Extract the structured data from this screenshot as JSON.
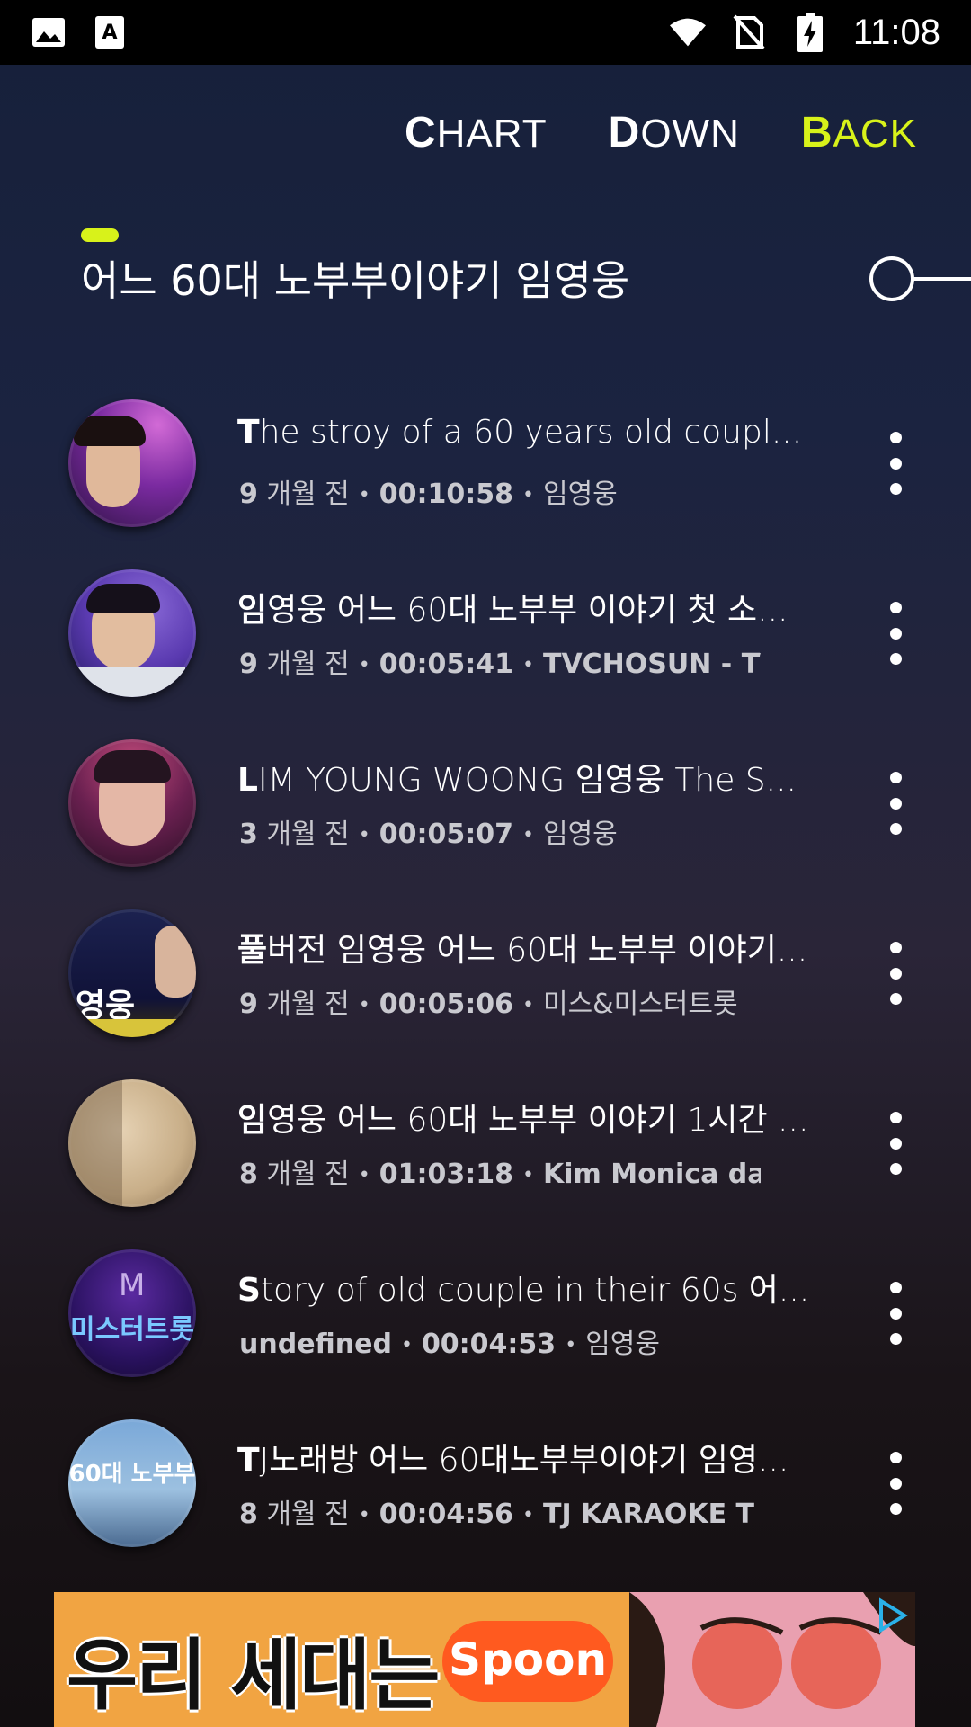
{
  "status_bar": {
    "time": "11:08",
    "icons": [
      "image-icon",
      "text-recognition-icon",
      "wifi-icon",
      "no-sim-icon",
      "battery-charging-icon"
    ]
  },
  "nav": {
    "chart_first": "C",
    "chart_rest": "HART",
    "down_first": "D",
    "down_rest": "OWN",
    "back_first": "B",
    "back_rest": "ACK",
    "active": "BACK",
    "accent_color": "#d8f21a"
  },
  "page": {
    "title": "어느 60대 노부부이야기 임영웅"
  },
  "songs": [
    {
      "title_cap": "T",
      "title_rest": "he stroy of a 60 years old coupl...",
      "age": "9",
      "age_unit": "개월 전",
      "duration": "00:10:58",
      "channel": "임영웅",
      "channel_bold": false,
      "thumb_label": ""
    },
    {
      "title_cap": "임",
      "title_rest": "영웅 어느 60대 노부부 이야기 첫 소...",
      "age": "9",
      "age_unit": "개월 전",
      "duration": "00:05:41",
      "channel": "TVCHOSUN - T\\",
      "channel_bold": true,
      "thumb_label": ""
    },
    {
      "title_cap": "L",
      "title_rest": "IM YOUNG WOONG 임영웅 The S...",
      "age": "3",
      "age_unit": "개월 전",
      "duration": "00:05:07",
      "channel": "임영웅",
      "channel_bold": false,
      "thumb_label": ""
    },
    {
      "title_cap": "풀",
      "title_rest": "버전 임영웅 어느 60대 노부부 이야기...",
      "age": "9",
      "age_unit": "개월 전",
      "duration": "00:05:06",
      "channel": "미스&미스터트롯",
      "channel_bold": false,
      "thumb_label": "영웅"
    },
    {
      "title_cap": "임",
      "title_rest": "영웅 어느 60대 노부부 이야기 1시간 ...",
      "age": "8",
      "age_unit": "개월 전",
      "duration": "01:03:18",
      "channel": "Kim Monica danc",
      "channel_bold": true,
      "thumb_label": ""
    },
    {
      "title_cap": "S",
      "title_rest": "tory of old couple in their 60s 어...",
      "age": "undefined",
      "age_unit": "",
      "duration": "00:04:53",
      "channel": "임영웅",
      "channel_bold": false,
      "thumb_label": "미스터트롯"
    },
    {
      "title_cap": "T",
      "title_rest": "J노래방 어느 60대노부부이야기 임영...",
      "age": "8",
      "age_unit": "개월 전",
      "duration": "00:04:56",
      "channel": "TJ KARAOKE T",
      "channel_bold": true,
      "thumb_label": "60대 노부부"
    }
  ],
  "ad": {
    "headline": "우리 세대는",
    "brand": "Spoon"
  }
}
